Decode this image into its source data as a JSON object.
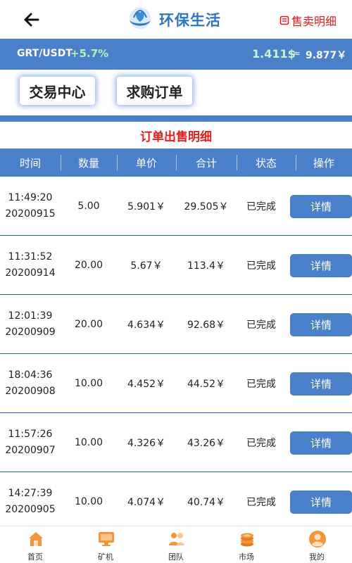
{
  "header": {
    "brand_title": "环保生活",
    "record_link": "售卖明细"
  },
  "ticker": {
    "pair": "GRT/USDT",
    "change": "+5.7%",
    "price_usd": "1.411$",
    "approx": "≈",
    "price_cny": "9.877￥"
  },
  "tabs": {
    "trade_center": "交易中心",
    "buy_orders": "求购订单"
  },
  "section_title": "订单出售明细",
  "table": {
    "headers": [
      "时间",
      "数量",
      "单价",
      "合计",
      "状态",
      "操作"
    ],
    "rows": [
      {
        "time": "11:49:20",
        "date": "20200915",
        "qty": "5.00",
        "price": "5.901￥",
        "total": "29.505￥",
        "status": "已完成",
        "action": "详情"
      },
      {
        "time": "11:31:52",
        "date": "20200914",
        "qty": "20.00",
        "price": "5.67￥",
        "total": "113.4￥",
        "status": "已完成",
        "action": "详情"
      },
      {
        "time": "12:01:39",
        "date": "20200909",
        "qty": "20.00",
        "price": "4.634￥",
        "total": "92.68￥",
        "status": "已完成",
        "action": "详情"
      },
      {
        "time": "18:04:36",
        "date": "20200908",
        "qty": "10.00",
        "price": "4.452￥",
        "total": "44.52￥",
        "status": "已完成",
        "action": "详情"
      },
      {
        "time": "11:57:26",
        "date": "20200907",
        "qty": "10.00",
        "price": "4.326￥",
        "total": "43.26￥",
        "status": "已完成",
        "action": "详情"
      },
      {
        "time": "14:27:39",
        "date": "20200905",
        "qty": "10.00",
        "price": "4.074￥",
        "total": "40.74￥",
        "status": "已完成",
        "action": "详情"
      }
    ]
  },
  "tabbar": {
    "items": [
      {
        "label": "首页",
        "icon": "home-icon"
      },
      {
        "label": "矿机",
        "icon": "monitor-icon"
      },
      {
        "label": "团队",
        "icon": "team-icon"
      },
      {
        "label": "市场",
        "icon": "coins-icon"
      },
      {
        "label": "我的",
        "icon": "user-icon"
      }
    ]
  },
  "colors": {
    "primary": "#4a7fc9",
    "accent_red": "#e41c1c",
    "positive_green": "#b3f0b5",
    "tab_icon_orange": "#f5953a"
  }
}
